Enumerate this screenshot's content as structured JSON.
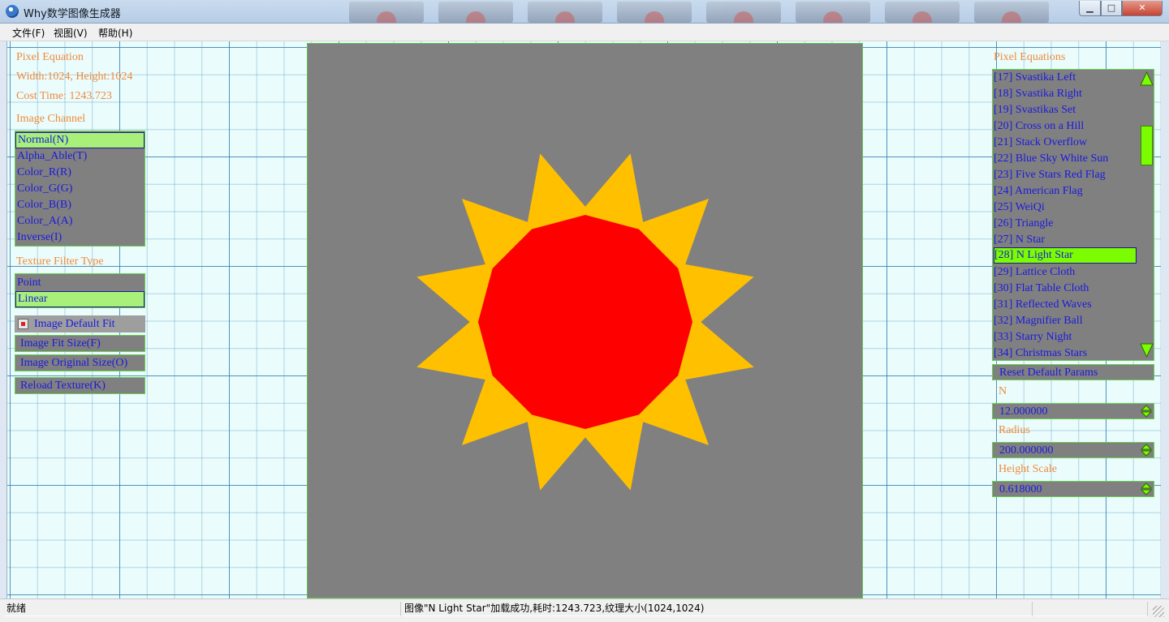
{
  "window": {
    "title": "Why数学图像生成器",
    "min_symbol": "▁",
    "max_symbol": "□",
    "close_symbol": "✕"
  },
  "menu": {
    "items": [
      "文件(F)",
      "视图(V)",
      "帮助(H)"
    ]
  },
  "left_panel": {
    "pixel_equation_label": "Pixel Equation",
    "size_text": "Width:1024, Height:1024",
    "cost_time_text": "Cost Time: 1243.723",
    "image_channel_label": "Image Channel",
    "channels": [
      "Normal(N)",
      "Alpha_Able(T)",
      "Color_R(R)",
      "Color_G(G)",
      "Color_B(B)",
      "Color_A(A)",
      "Inverse(I)"
    ],
    "channel_selected": "Normal(N)",
    "texture_filter_label": "Texture Filter Type",
    "filters": [
      "Point",
      "Linear"
    ],
    "filter_selected": "Linear",
    "fit_default_label": "Image Default Fit",
    "fit_size_label": "Image Fit Size(F)",
    "original_size_label": "Image Original Size(O)",
    "reload_label": "Reload Texture(K)"
  },
  "right_panel": {
    "equations_label": "Pixel Equations",
    "equations": [
      "[17] Svastika Left",
      "[18] Svastika Right",
      "[19] Svastikas Set",
      "[20] Cross on a Hill",
      "[21] Stack Overflow",
      "[22] Blue Sky White Sun",
      "[23] Five Stars Red Flag",
      "[24] American Flag",
      "[25] WeiQi",
      "[26] Triangle",
      "[27] N Star",
      "[28] N Light Star",
      "[29] Lattice Cloth",
      "[30] Flat Table Cloth",
      "[31] Reflected Waves",
      "[32] Magnifier Ball",
      "[33] Starry Night",
      "[34] Christmas Stars"
    ],
    "equation_selected": "[28] N Light Star",
    "scroll_position": 0.32,
    "reset_label": "Reset Default Params",
    "params": [
      {
        "label": "N",
        "value": "12.000000"
      },
      {
        "label": "Radius",
        "value": "200.000000"
      },
      {
        "label": "Height Scale",
        "value": "0.618000"
      }
    ]
  },
  "canvas": {
    "image_name": "N Light Star",
    "star_points": 12,
    "radius": 200,
    "height_scale": 0.618,
    "colors": {
      "background": "#808080",
      "rays": "#ffc000",
      "center": "#ff0000"
    }
  },
  "status": {
    "ready": "就绪",
    "message": "图像\"N Light Star\"加载成功,耗时:1243.723,纹理大小(1024,1024)"
  }
}
